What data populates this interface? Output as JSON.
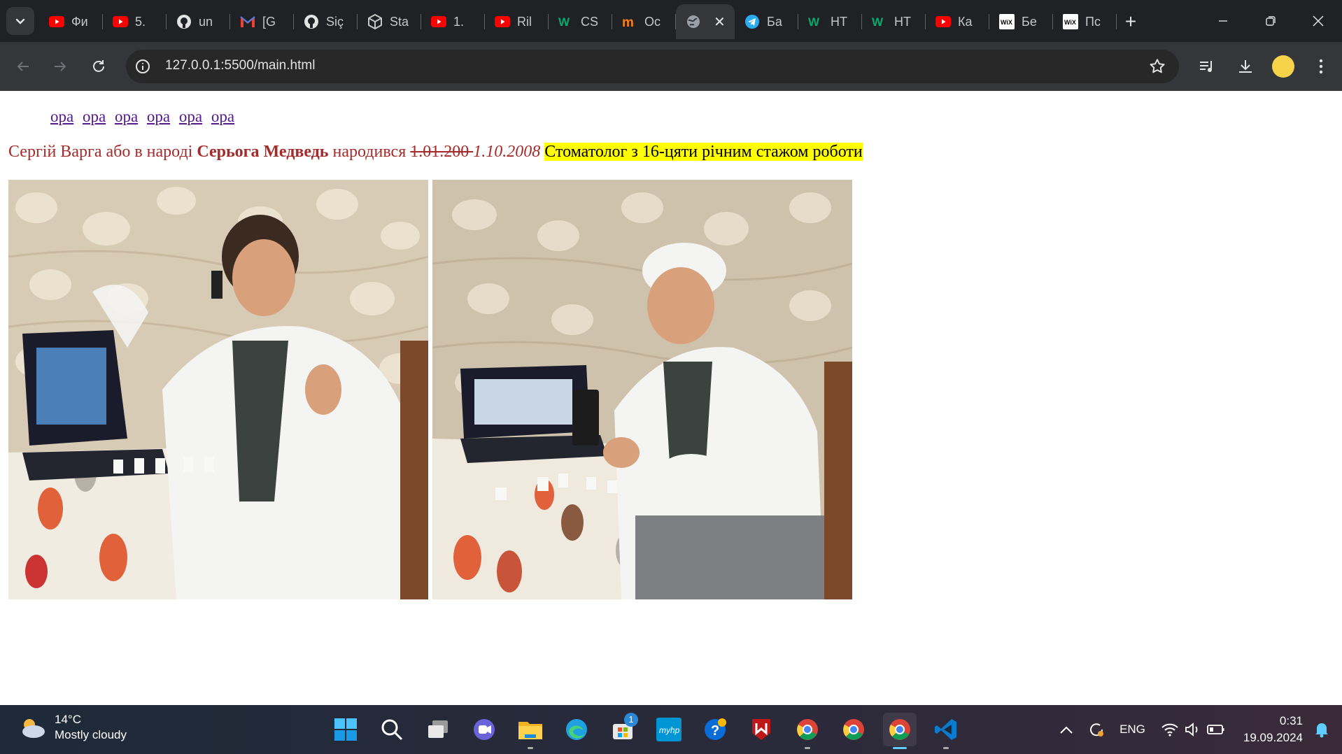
{
  "browser": {
    "tabs": [
      {
        "title": "Фи",
        "icon": "youtube-icon"
      },
      {
        "title": "5.",
        "icon": "youtube-icon"
      },
      {
        "title": "un",
        "icon": "github-icon"
      },
      {
        "title": "[G",
        "icon": "gmail-icon"
      },
      {
        "title": "Siç",
        "icon": "github-icon"
      },
      {
        "title": "Sta",
        "icon": "unity-icon"
      },
      {
        "title": "1.",
        "icon": "youtube-icon"
      },
      {
        "title": "Ril",
        "icon": "youtube-icon"
      },
      {
        "title": "CS",
        "icon": "w3schools-icon"
      },
      {
        "title": "Oc",
        "icon": "moodle-icon"
      },
      {
        "title": "",
        "icon": "globe-icon",
        "active": true
      },
      {
        "title": "Ба",
        "icon": "telegram-icon"
      },
      {
        "title": "НТ",
        "icon": "w3schools-icon"
      },
      {
        "title": "НТ",
        "icon": "w3schools-icon"
      },
      {
        "title": "Ка",
        "icon": "youtube-icon"
      },
      {
        "title": "Бе",
        "icon": "wix-icon"
      },
      {
        "title": "Пс",
        "icon": "wix-icon"
      }
    ],
    "url": "127.0.0.1:5500/main.html"
  },
  "page": {
    "nav_links": [
      "ора",
      "ора",
      "ора",
      "ора",
      "ора",
      "ора"
    ],
    "bio": {
      "intro": "Сергій Варга або в народі ",
      "nickname": "Серьога Медведь",
      "born": " народився ",
      "old_date": "1.01.200 ",
      "new_date": "1.10.2008",
      "space": " ",
      "highlight": "Стоматолог з 16-цяти річним стажом роботи"
    },
    "colors": {
      "text": "#a52a2a",
      "highlight": "#ffff00",
      "link": "#551a8b"
    }
  },
  "taskbar": {
    "weather_temp": "14°C",
    "weather_desc": "Mostly cloudy",
    "language": "ENG",
    "time": "0:31",
    "date": "19.09.2024",
    "store_badge": "1",
    "apps": [
      "windows-start-icon",
      "search-icon",
      "task-view-icon",
      "teams-icon",
      "file-explorer-icon",
      "edge-icon",
      "store-icon",
      "myhp-icon",
      "help-icon",
      "mcafee-icon",
      "chrome-profile-icon",
      "chrome-icon",
      "chrome-active-icon",
      "vscode-icon"
    ]
  }
}
